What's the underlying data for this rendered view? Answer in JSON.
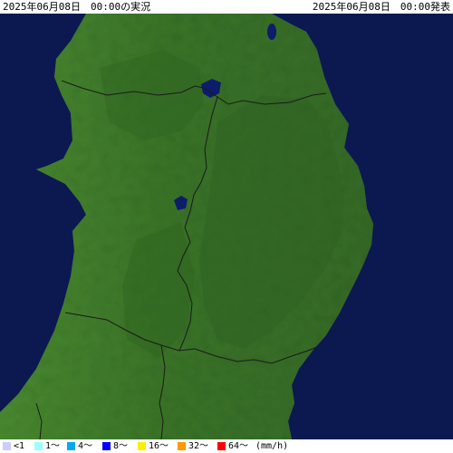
{
  "header": {
    "observation_time": "2025年06月08日　00:00の実況",
    "issued_time": "2025年06月08日　00:00発表"
  },
  "map": {
    "sea_color": "#0b1950",
    "land_color": "#3d7a2a",
    "lake_color": "#0d1c6b",
    "border_color": "#1a1a1a"
  },
  "legend": {
    "items": [
      {
        "label": "<1",
        "color": "#ccccff"
      },
      {
        "label": "1〜",
        "color": "#99ffff"
      },
      {
        "label": "4〜",
        "color": "#00aaee"
      },
      {
        "label": "8〜",
        "color": "#0000ff"
      },
      {
        "label": "16〜",
        "color": "#ffee00"
      },
      {
        "label": "32〜",
        "color": "#ff9900"
      },
      {
        "label": "64〜",
        "color": "#ff0000"
      }
    ],
    "unit": "(mm/h)"
  }
}
